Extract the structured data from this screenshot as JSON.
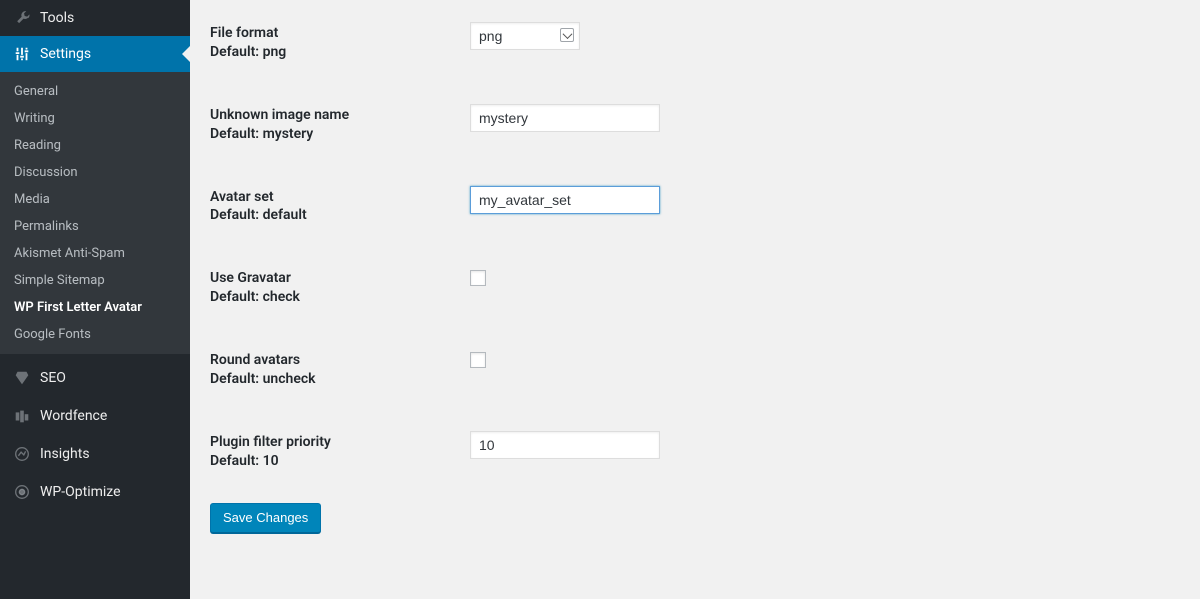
{
  "sidebar": {
    "tools": "Tools",
    "settings": "Settings",
    "submenu": [
      "General",
      "Writing",
      "Reading",
      "Discussion",
      "Media",
      "Permalinks",
      "Akismet Anti-Spam",
      "Simple Sitemap",
      "WP First Letter Avatar",
      "Google Fonts"
    ],
    "active_submenu_index": 8,
    "bottom": [
      "SEO",
      "Wordfence",
      "Insights",
      "WP-Optimize"
    ]
  },
  "fields": {
    "file_format": {
      "label": "File format",
      "default_label": "Default: png",
      "value": "png"
    },
    "unknown_image": {
      "label": "Unknown image name",
      "default_label": "Default: mystery",
      "value": "mystery"
    },
    "avatar_set": {
      "label": "Avatar set",
      "default_label": "Default: default",
      "value": "my_avatar_set"
    },
    "use_gravatar": {
      "label": "Use Gravatar",
      "default_label": "Default: check",
      "checked": false
    },
    "round_avatars": {
      "label": "Round avatars",
      "default_label": "Default: uncheck",
      "checked": false
    },
    "filter_priority": {
      "label": "Plugin filter priority",
      "default_label": "Default: 10",
      "value": "10"
    }
  },
  "buttons": {
    "save": "Save Changes"
  },
  "colors": {
    "accent": "#0073aa",
    "button": "#0085ba"
  }
}
